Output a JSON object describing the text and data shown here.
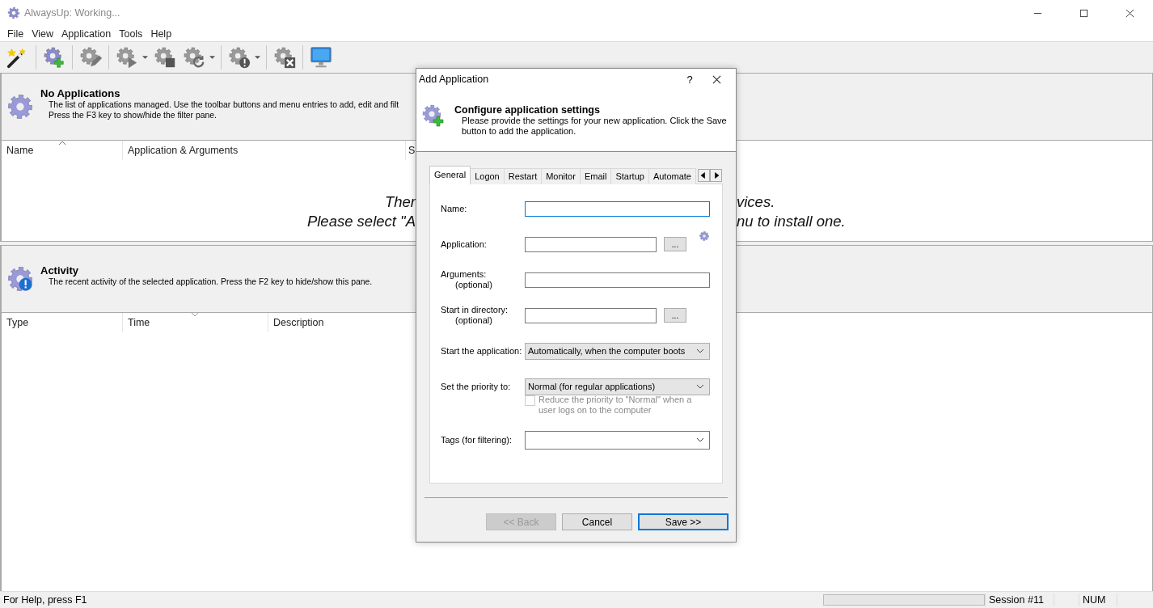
{
  "window": {
    "title": "AlwaysUp: Working..."
  },
  "menu": [
    "File",
    "View",
    "Application",
    "Tools",
    "Help"
  ],
  "apps_pane": {
    "title": "No Applications",
    "description_lines": [
      "The list of applications managed. Use the toolbar buttons and menu entries to add, edit and filt",
      "Press the F3 key to show/hide the filter pane."
    ],
    "columns": [
      {
        "label": "Name",
        "sort_up": true,
        "sort_down": false
      },
      {
        "label": "Application & Arguments",
        "sort_up": false,
        "sort_down": false
      },
      {
        "label": "S",
        "sort_up": false,
        "sort_down": false
      }
    ],
    "empty_message_left": [
      "Ther",
      "Please select \"A"
    ],
    "empty_message_right": [
      "vices.",
      "nu to install one."
    ]
  },
  "activity_pane": {
    "title": "Activity",
    "description": "The recent activity of the selected application. Press the F2 key to hide/show this pane.",
    "columns": [
      {
        "label": "Type",
        "sort_up": false,
        "sort_down": false
      },
      {
        "label": "Time",
        "sort_up": false,
        "sort_down": true
      },
      {
        "label": "Description",
        "sort_up": false,
        "sort_down": false
      }
    ]
  },
  "status_bar": {
    "help": "For Help, press F1",
    "progress": {
      "level": 0
    },
    "session": "Session #11",
    "num": "NUM"
  },
  "dialog": {
    "title": "Add Application",
    "help_label": "?",
    "heading": "Configure application settings",
    "subheading": "Please provide the settings for your new application. Click the Save button to add the application.",
    "tabs": [
      {
        "label": "General",
        "selected": true
      },
      {
        "label": "Logon",
        "selected": false
      },
      {
        "label": "Restart",
        "selected": false
      },
      {
        "label": "Monitor",
        "selected": false
      },
      {
        "label": "Email",
        "selected": false
      },
      {
        "label": "Startup",
        "selected": false
      },
      {
        "label": "Automate",
        "selected": false
      }
    ],
    "fields": [
      {
        "kind": "text",
        "label": "Name:",
        "focused": true
      },
      {
        "kind": "browse",
        "label": "Application:",
        "browse_label": "...",
        "focused": false,
        "extra_icon": true
      },
      {
        "kind": "text",
        "label": "Arguments:",
        "sublabel": "(optional)",
        "focused": false
      },
      {
        "kind": "browse",
        "label": "Start in directory:",
        "sublabel": "(optional)",
        "browse_label": "...",
        "focused": false
      },
      {
        "kind": "select",
        "label": "Start the application:",
        "value": "Automatically, when the computer boots"
      },
      {
        "kind": "select",
        "label": "Set the priority to:",
        "value": "Normal (for regular applications)"
      },
      {
        "kind": "checkbox",
        "label": "Reduce the priority to \"Normal\" when a user logs on to the computer",
        "checked": false,
        "disabled": true
      },
      {
        "kind": "combo",
        "label": "Tags (for filtering):"
      }
    ],
    "buttons": [
      {
        "label": "<< Back",
        "disabled": true,
        "default": false
      },
      {
        "label": "Cancel",
        "disabled": false,
        "default": false
      },
      {
        "label": "Save >>",
        "disabled": false,
        "default": true
      }
    ]
  }
}
